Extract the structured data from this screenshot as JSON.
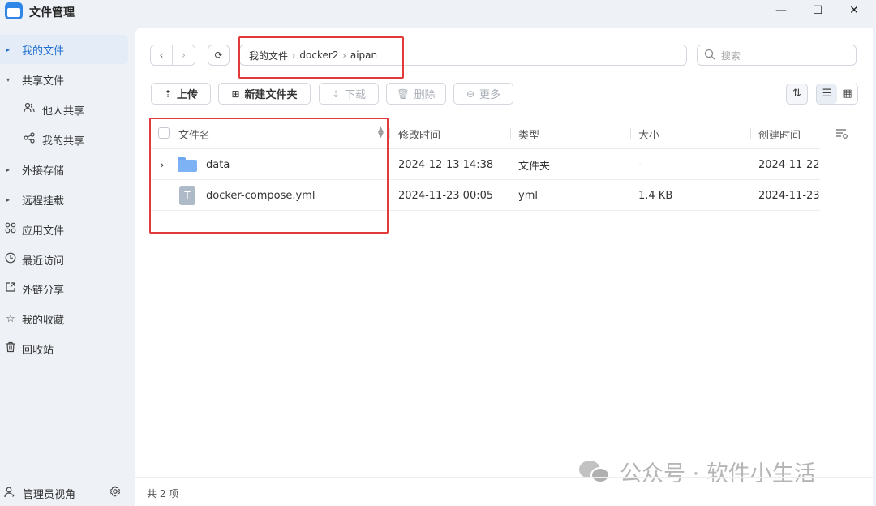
{
  "window": {
    "title": "文件管理",
    "minimize": "—",
    "maximize": "☐",
    "close": "✕"
  },
  "sidebar": {
    "items": [
      {
        "label": "我的文件",
        "icon": "caret-right",
        "active": true
      },
      {
        "label": "共享文件",
        "icon": "caret-down",
        "active": false
      },
      {
        "label": "他人共享",
        "icon": "people-icon",
        "active": false
      },
      {
        "label": "我的共享",
        "icon": "share-icon",
        "active": false
      },
      {
        "label": "外接存储",
        "icon": "caret-right",
        "active": false
      },
      {
        "label": "远程挂载",
        "icon": "caret-right",
        "active": false
      },
      {
        "label": "应用文件",
        "icon": "apps-icon",
        "active": false
      },
      {
        "label": "最近访问",
        "icon": "clock-icon",
        "active": false
      },
      {
        "label": "外链分享",
        "icon": "link-share-icon",
        "active": false
      },
      {
        "label": "我的收藏",
        "icon": "star-icon",
        "active": false
      },
      {
        "label": "回收站",
        "icon": "trash-icon",
        "active": false
      }
    ],
    "footer": {
      "label": "管理员视角",
      "icon": "user-icon",
      "settings_icon": "gear-icon"
    }
  },
  "breadcrumb": {
    "items": [
      "我的文件",
      "docker2",
      "aipan"
    ]
  },
  "search": {
    "placeholder": "搜索"
  },
  "toolbar": {
    "upload": "上传",
    "new_folder": "新建文件夹",
    "download": "下载",
    "delete": "删除",
    "more": "更多"
  },
  "table": {
    "columns": [
      "文件名",
      "修改时间",
      "类型",
      "大小",
      "创建时间"
    ],
    "rows": [
      {
        "name": "data",
        "modified": "2024-12-13 14:38",
        "type": "文件夹",
        "size": "-",
        "created": "2024-11-22",
        "kind": "folder"
      },
      {
        "name": "docker-compose.yml",
        "modified": "2024-11-23 00:05",
        "type": "yml",
        "size": "1.4 KB",
        "created": "2024-11-23",
        "kind": "file",
        "file_glyph": "T"
      }
    ]
  },
  "status": {
    "count_text": "共 2 项"
  },
  "watermark": {
    "text": "公众号 · 软件小生活"
  },
  "colors": {
    "accent": "#1f6fd0",
    "highlight_box": "#e23a3a",
    "sidebar_bg": "#eef2f7",
    "folder": "#7db3f5"
  }
}
